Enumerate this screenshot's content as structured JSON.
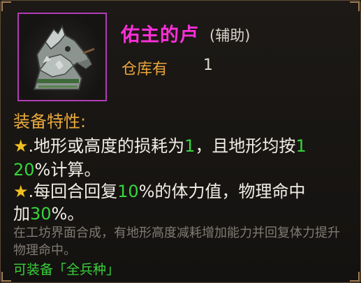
{
  "item": {
    "name": "佑主的卢",
    "type": "(辅助)",
    "stock_label": "仓库有",
    "stock_count": "1",
    "icon": "armored-warhorse-icon",
    "rarity_color": "#b03cb6"
  },
  "attributes": {
    "title": "装备特性:",
    "star_glyph": "★",
    "effect1": {
      "p1": ".地形或高度的损耗为",
      "v1": "1",
      "p2": "，且地形均按",
      "v2a": "1",
      "v2b": "20",
      "p3": "%计算。"
    },
    "effect2": {
      "p1": ".每回合回复",
      "v1": "10",
      "p2": "%的体力值，物理命中",
      "p3": "加",
      "v2": "30",
      "p4": "%。"
    }
  },
  "description": "在工坊界面合成，有地形高度减耗增加能力并回复体力提升物理命中。",
  "usable_by": "可装备「全兵种」",
  "colors": {
    "name": "#ff2fd8",
    "highlight": "#36d63a",
    "label": "#e9a83c"
  }
}
